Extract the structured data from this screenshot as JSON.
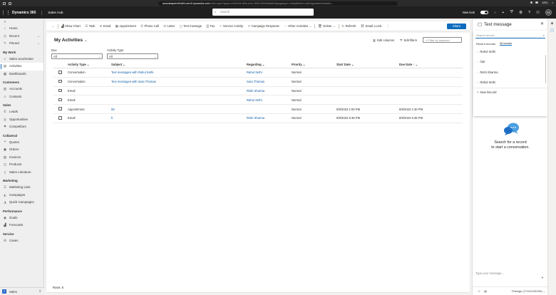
{
  "browser": {
    "host": "aurorabapenv51df4.crm10.dynamics.com",
    "path": "/main.aspx?appid=e92b2d4-8f0a-ee11-8df9-000d3a5a6e4&pagetype=entitylist&etn=activitypointer&viewid=...",
    "vpn_label": "VPN"
  },
  "app": {
    "brand": "Dynamics 365",
    "app_name": "Sales Hub",
    "search_placeholder": "Search",
    "new_look_label": "New look",
    "user_initials": "SS"
  },
  "nav": {
    "top": [
      {
        "label": "Home",
        "icon": "home-icon"
      },
      {
        "label": "Recent",
        "icon": "clock-icon",
        "chevron": true
      },
      {
        "label": "Pinned",
        "icon": "pin-icon",
        "chevron": true
      }
    ],
    "groups": [
      {
        "title": "My Work",
        "items": [
          {
            "label": "Sales accelerator",
            "icon": "rocket-icon"
          },
          {
            "label": "Activities",
            "icon": "clipboard-icon",
            "active": true
          },
          {
            "label": "Dashboards",
            "icon": "dashboard-icon"
          }
        ]
      },
      {
        "title": "Customers",
        "items": [
          {
            "label": "Accounts",
            "icon": "building-icon"
          },
          {
            "label": "Contacts",
            "icon": "person-icon"
          }
        ]
      },
      {
        "title": "Sales",
        "items": [
          {
            "label": "Leads",
            "icon": "phone-icon"
          },
          {
            "label": "Opportunities",
            "icon": "opportunity-icon"
          },
          {
            "label": "Competitors",
            "icon": "competitor-icon"
          }
        ]
      },
      {
        "title": "Collateral",
        "items": [
          {
            "label": "Quotes",
            "icon": "quote-icon"
          },
          {
            "label": "Orders",
            "icon": "order-icon"
          },
          {
            "label": "Invoices",
            "icon": "invoice-icon"
          },
          {
            "label": "Products",
            "icon": "box-icon"
          },
          {
            "label": "Sales Literature",
            "icon": "book-icon"
          }
        ]
      },
      {
        "title": "Marketing",
        "items": [
          {
            "label": "Marketing Lists",
            "icon": "list-icon"
          },
          {
            "label": "Campaigns",
            "icon": "megaphone-icon"
          },
          {
            "label": "Quick Campaigns",
            "icon": "quick-campaign-icon"
          }
        ]
      },
      {
        "title": "Performance",
        "items": [
          {
            "label": "Goals",
            "icon": "target-icon"
          },
          {
            "label": "Forecasts",
            "icon": "chart-icon"
          }
        ]
      },
      {
        "title": "Service",
        "items": [
          {
            "label": "Cases",
            "icon": "wrench-icon"
          }
        ]
      }
    ],
    "area": {
      "badge": "S",
      "label": "Sales"
    }
  },
  "commands": [
    {
      "label": "Show Chart",
      "icon": "chart-icon"
    },
    {
      "label": "Task",
      "icon": "task-icon"
    },
    {
      "label": "Email",
      "icon": "mail-icon"
    },
    {
      "label": "Appointment",
      "icon": "calendar-icon"
    },
    {
      "label": "Phone Call",
      "icon": "phone-icon"
    },
    {
      "label": "Letter",
      "icon": "letter-icon"
    },
    {
      "label": "Text message",
      "icon": "message-icon"
    },
    {
      "label": "Fax",
      "icon": "fax-icon"
    },
    {
      "label": "Service Activity",
      "icon": "service-icon"
    },
    {
      "label": "Campaign Response",
      "icon": "response-icon"
    },
    {
      "label": "Other Activities",
      "icon": "activities-icon"
    },
    {
      "label": "Delete",
      "icon": "trash-icon"
    },
    {
      "label": "Refresh",
      "icon": "refresh-icon"
    },
    {
      "label": "Email a Link",
      "icon": "link-icon"
    }
  ],
  "share_label": "Share",
  "view": {
    "title": "My Activities",
    "edit_columns": "Edit columns",
    "edit_filters": "Edit filters",
    "filter_placeholder": "Filter by keyword",
    "filters": [
      {
        "label": "Due",
        "value": "All"
      },
      {
        "label": "Activity Type",
        "value": "All"
      }
    ],
    "columns": [
      "Activity Type",
      "Subject",
      "Regarding",
      "Priority",
      "Start Date",
      "Due Date"
    ],
    "rows": [
      {
        "type": "Conversation",
        "subject": "Text messages with Rahul Sethi",
        "regarding": "Rahul Sethi",
        "priority": "Normal",
        "start": "",
        "due": ""
      },
      {
        "type": "Conversation",
        "subject": "Text messages with Sara Thomas",
        "regarding": "Sara Thomas",
        "priority": "Normal",
        "start": "",
        "due": ""
      },
      {
        "type": "Email",
        "subject": "",
        "regarding": "Rishi Sharma",
        "priority": "Normal",
        "start": "",
        "due": ""
      },
      {
        "type": "Email",
        "subject": "",
        "regarding": "Rahul Sethi",
        "priority": "Normal",
        "start": "",
        "due": ""
      },
      {
        "type": "Appointment",
        "subject": "55",
        "regarding": "",
        "priority": "Normal",
        "start": "8/9/2023 1:00 PM",
        "due": "8/9/2023 1:30 PM"
      },
      {
        "type": "Email",
        "subject": "fr",
        "regarding": "Rishi Sharma",
        "priority": "Normal",
        "start": "8/9/2023 5:35 PM",
        "due": "8/9/2023 5:35 PM"
      }
    ],
    "rows_count": "Rows: 6"
  },
  "sidepane": {
    "title": "Text message",
    "search_placeholder": "Search record",
    "tab_recent": "Recent records",
    "tab_all": "All records",
    "records": [
      "Rahul Sethi",
      "Opt",
      "Rishi Sharma",
      "Rahul Sethi"
    ],
    "new_record": "New Record",
    "empty_line1": "Search for a record",
    "empty_line2": "to start a conversation.",
    "input_placeholder": "Type your message...",
    "sender": "Telesign (17102126299)"
  }
}
